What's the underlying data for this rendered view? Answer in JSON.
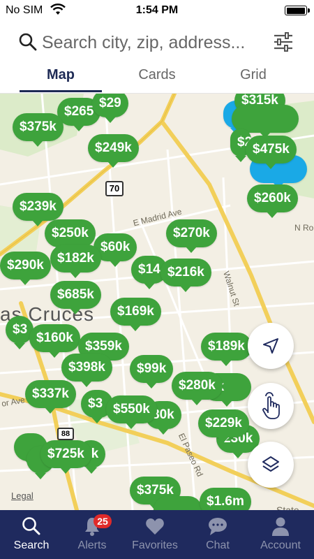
{
  "status_bar": {
    "carrier": "No SIM",
    "time": "1:54 PM"
  },
  "search": {
    "placeholder": "Search city, zip, address..."
  },
  "tabs": [
    {
      "label": "Map",
      "active": true
    },
    {
      "label": "Cards",
      "active": false
    },
    {
      "label": "Grid",
      "active": false
    }
  ],
  "map": {
    "labels": {
      "highway": "70",
      "madrid": "E Madrid Ave",
      "walnut": "Walnut St",
      "elpaseo": "El Paseo Rd",
      "nro": "N Ro",
      "orave": "or Ave",
      "city": "as Cruces",
      "state": "State",
      "legal": "Legal",
      "br88": "88"
    },
    "pins": {
      "p1": "$375k",
      "p2": "$265",
      "p3": "$29",
      "p4": "$249k",
      "p5": "$315k",
      "p6": "$475k",
      "p7": "$260k",
      "p8": "$239k",
      "p9": "$250k",
      "p10": "$60k",
      "p11": "$270k",
      "p12": "$182k",
      "p13": "$290k",
      "p14": "$14",
      "p15": "$216k",
      "p16": "$685k",
      "p17": "$169k",
      "p18": "$160k",
      "p19": "$359k",
      "p20": "$398k",
      "p21": "$99k",
      "p22": "$189k",
      "p23": "$280k",
      "p24": "$337k",
      "p25": "$550k",
      "p26": "80k",
      "p27": "$229k",
      "p28": "230k",
      "p29": "$725k",
      "p30": "4k",
      "p31": "$375k",
      "p32": "$1.6m",
      "p33": "$2",
      "p34": "$3",
      "p35": "0k",
      "p36": "$3"
    }
  },
  "nav": {
    "items": [
      {
        "label": "Search",
        "icon": "search-icon",
        "active": true
      },
      {
        "label": "Alerts",
        "icon": "bell-icon",
        "badge": "25"
      },
      {
        "label": "Favorites",
        "icon": "heart-icon"
      },
      {
        "label": "Chat",
        "icon": "chat-bubble-icon"
      },
      {
        "label": "Account",
        "icon": "person-icon"
      }
    ]
  },
  "colors": {
    "pin_green": "#3ea33c",
    "pin_blue": "#1aa9e6",
    "nav_bg": "#1f2a5e",
    "accent": "#1e2a55"
  }
}
